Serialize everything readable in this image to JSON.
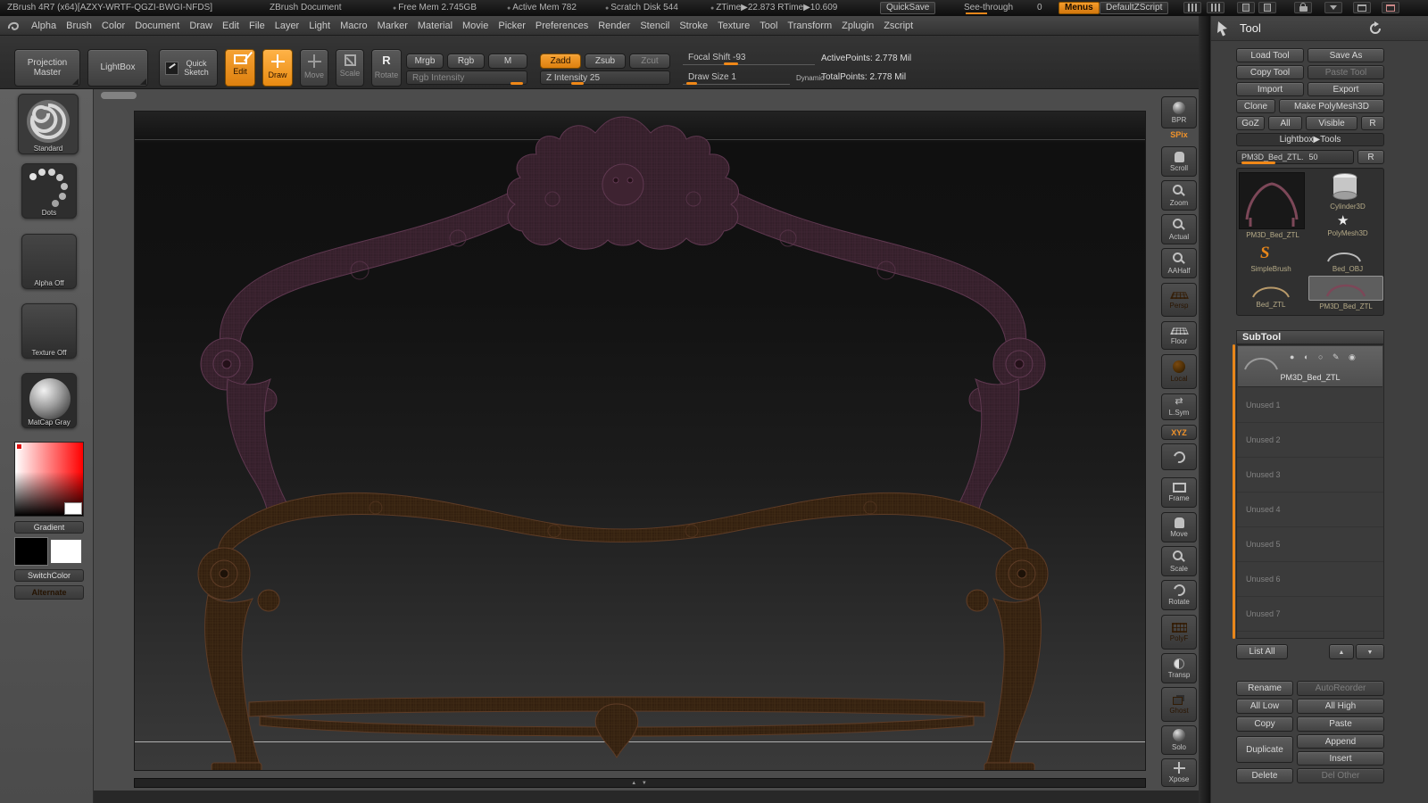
{
  "accent": "#e8861a",
  "titlebar": {
    "app_title": "ZBrush 4R7 (x64)[AZXY-WRTF-QGZI-BWGI-NFDS]",
    "doc_title": "ZBrush Document",
    "stats": [
      "Free Mem 2.745GB",
      "Active Mem 782",
      "Scratch Disk 544",
      "ZTime▶22.873 RTime▶10.609"
    ],
    "quicksave": "QuickSave",
    "see_through_label": "See-through",
    "see_through_value": "0",
    "menus": "Menus",
    "default_zscript": "DefaultZScript"
  },
  "menubar": {
    "items": [
      "Alpha",
      "Brush",
      "Color",
      "Document",
      "Draw",
      "Edit",
      "File",
      "Layer",
      "Light",
      "Macro",
      "Marker",
      "Material",
      "Movie",
      "Picker",
      "Preferences",
      "Render",
      "Stencil",
      "Stroke",
      "Texture",
      "Tool",
      "Transform",
      "Zplugin",
      "Zscript"
    ]
  },
  "shelf": {
    "projection_master": "Projection Master",
    "lightbox": "LightBox",
    "quick_sketch": "Quick Sketch",
    "edit": "Edit",
    "draw": "Draw",
    "move": "Move",
    "scale": "Scale",
    "rotate": "Rotate",
    "rotate_r": "R",
    "mrgb": "Mrgb",
    "rgb": "Rgb",
    "m": "M",
    "zadd": "Zadd",
    "zsub": "Zsub",
    "zcut": "Zcut",
    "rgb_intensity": "Rgb Intensity",
    "z_intensity": "Z Intensity 25",
    "focal_shift": "Focal Shift -93",
    "draw_size": "Draw Size 1",
    "dynamic": "Dynamic",
    "active_points": "ActivePoints: 2.778 Mil",
    "total_points": "TotalPoints: 2.778 Mil"
  },
  "left_tray": {
    "standard": "Standard",
    "dots": "Dots",
    "alpha_off": "Alpha Off",
    "texture_off": "Texture Off",
    "matcap": "MatCap Gray",
    "gradient": "Gradient",
    "switchcolor": "SwitchColor",
    "alternate": "Alternate"
  },
  "right_shelf": {
    "items": [
      {
        "label": "BPR"
      },
      {
        "label": "SPix"
      },
      {
        "label": "Scroll"
      },
      {
        "label": "Zoom"
      },
      {
        "label": "Actual"
      },
      {
        "label": "AAHalf"
      },
      {
        "label": "Persp"
      },
      {
        "label": "Floor"
      },
      {
        "label": "Local"
      },
      {
        "label": "L.Sym"
      },
      {
        "label": "XYZ"
      },
      {
        "label": ""
      },
      {
        "label": "Frame"
      },
      {
        "label": "Move"
      },
      {
        "label": "Scale"
      },
      {
        "label": "Rotate"
      },
      {
        "label": "PolyF"
      },
      {
        "label": "Transp"
      },
      {
        "label": "Ghost"
      },
      {
        "label": "Solo"
      },
      {
        "label": "Xpose"
      }
    ]
  },
  "tool_panel": {
    "title": "Tool",
    "load_tool": "Load Tool",
    "save_as": "Save As",
    "copy_tool": "Copy Tool",
    "paste_tool": "Paste Tool",
    "import": "Import",
    "export": "Export",
    "clone": "Clone",
    "make_polymesh": "Make PolyMesh3D",
    "goz": "GoZ",
    "all": "All",
    "visible": "Visible",
    "r": "R",
    "lightbox_tools": "Lightbox▶Tools",
    "current_tool": "PM3D_Bed_ZTL.",
    "current_value": "50",
    "current_r": "R",
    "thumbs": {
      "big": "PM3D_Bed_ZTL",
      "cylinder": "Cylinder3D",
      "polymesh": "PolyMesh3D",
      "simplebrush": "SimpleBrush",
      "bed_obj": "Bed_OBJ",
      "bed_ztl": "Bed_ZTL",
      "pm3d_sel": "PM3D_Bed_ZTL"
    },
    "subtool": {
      "title": "SubTool",
      "active": "PM3D_Bed_ZTL",
      "unused": [
        "Unused 1",
        "Unused 2",
        "Unused 3",
        "Unused 4",
        "Unused 5",
        "Unused 6",
        "Unused 7"
      ],
      "list_all": "List All",
      "rename": "Rename",
      "autoreorder": "AutoReorder",
      "all_low": "All Low",
      "all_high": "All High",
      "copy": "Copy",
      "paste": "Paste",
      "duplicate": "Duplicate",
      "append": "Append",
      "insert": "Insert",
      "delete": "Delete",
      "del_other": "Del Other"
    }
  }
}
